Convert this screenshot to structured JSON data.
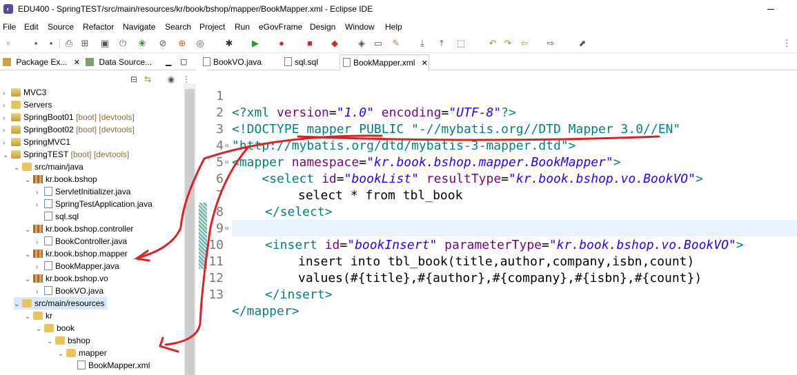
{
  "window": {
    "title": "EDU400 - SpringTEST/src/main/resources/kr/book/bshop/mapper/BookMapper.xml - Eclipse IDE"
  },
  "menu": [
    "File",
    "Edit",
    "Source",
    "Refactor",
    "Navigate",
    "Search",
    "Project",
    "Run",
    "eGovFrame",
    "Design",
    "Window",
    "Help"
  ],
  "left_tabs": {
    "package_explorer": "Package Ex...",
    "data_source": "Data Source..."
  },
  "tree": [
    {
      "label": "MVC3",
      "tag": ""
    },
    {
      "label": "Servers",
      "tag": ""
    },
    {
      "label": "SpringBoot01",
      "tag": "[boot] [devtools]"
    },
    {
      "label": "SpringBoot02",
      "tag": "[boot] [devtools]"
    },
    {
      "label": "SpringMVC1",
      "tag": ""
    },
    {
      "label": "SpringTEST",
      "tag": "[boot] [devtools]"
    },
    {
      "label": "src/main/java",
      "tag": ""
    },
    {
      "label": "kr.book.bshop",
      "tag": ""
    },
    {
      "label": "ServletInitializer.java",
      "tag": ""
    },
    {
      "label": "SpringTestApplication.java",
      "tag": ""
    },
    {
      "label": "sql.sql",
      "tag": ""
    },
    {
      "label": "kr.book.bshop.controller",
      "tag": ""
    },
    {
      "label": "BookController.java",
      "tag": ""
    },
    {
      "label": "kr.book.bshop.mapper",
      "tag": ""
    },
    {
      "label": "BookMapper.java",
      "tag": ""
    },
    {
      "label": "kr.book.bshop.vo",
      "tag": ""
    },
    {
      "label": "BookVO.java",
      "tag": ""
    },
    {
      "label": "src/main/resources",
      "tag": ""
    },
    {
      "label": "kr",
      "tag": ""
    },
    {
      "label": "book",
      "tag": ""
    },
    {
      "label": "bshop",
      "tag": ""
    },
    {
      "label": "mapper",
      "tag": ""
    },
    {
      "label": "BookMapper.xml",
      "tag": ""
    }
  ],
  "editor_tabs": [
    "BookVO.java",
    "sql.sql",
    "BookMapper.xml"
  ],
  "code": {
    "l1": {
      "a": "<?xml ",
      "b": "version",
      "c": "=",
      "d": "\"1.0\"",
      "e": " encoding",
      "f": "=",
      "g": "\"UTF-8\"",
      "h": "?>"
    },
    "l2": "<!DOCTYPE mapper PUBLIC \"-//mybatis.org//DTD Mapper 3.0//EN\"",
    "l3": "\"http://mybatis.org/dtd/mybatis-3-mapper.dtd\">",
    "l4": {
      "a": "<mapper ",
      "b": "namespace",
      "c": "=",
      "d": "\"kr.book.bshop.mapper.BookMapper\"",
      "e": ">"
    },
    "l5": {
      "a": "<select ",
      "b": "id",
      "c": "=",
      "d": "\"bookList\"",
      "e": " resultType",
      "f": "=",
      "g": "\"kr.book.bshop.vo.BookVO\"",
      "h": ">"
    },
    "l6": "select * from tbl_book",
    "l7": "</select>",
    "l8": "",
    "l9": {
      "a": "<insert ",
      "b": "id",
      "c": "=",
      "d": "\"bookInsert\"",
      "e": " parameterType",
      "f": "=",
      "g": "\"kr.book.bshop.vo.BookVO\"",
      "h": ">"
    },
    "l10": "insert into tbl_book(title,author,company,isbn,count)",
    "l11": "values(#{title},#{author},#{company},#{isbn},#{count})",
    "l12": "</insert>",
    "l13": "</mapper>"
  },
  "annotation_color": "#e02020"
}
